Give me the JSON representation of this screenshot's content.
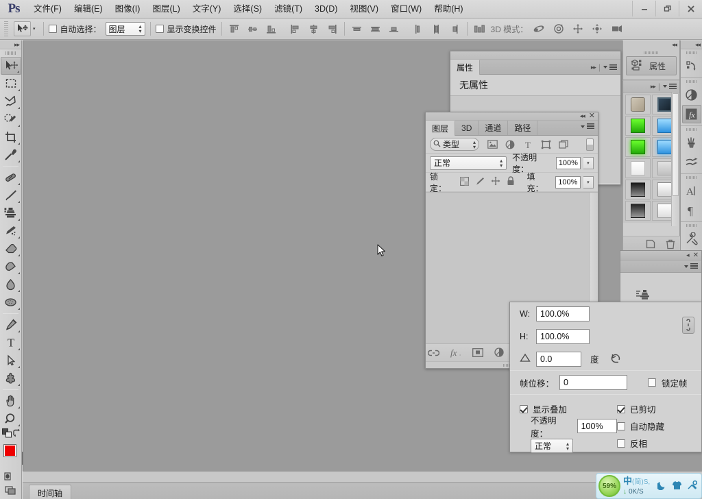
{
  "app": {
    "logo": "Ps"
  },
  "menubar": {
    "items": [
      {
        "label": "文件(F)"
      },
      {
        "label": "编辑(E)"
      },
      {
        "label": "图像(I)"
      },
      {
        "label": "图层(L)"
      },
      {
        "label": "文字(Y)"
      },
      {
        "label": "选择(S)"
      },
      {
        "label": "滤镜(T)"
      },
      {
        "label": "3D(D)"
      },
      {
        "label": "视图(V)"
      },
      {
        "label": "窗口(W)"
      },
      {
        "label": "帮助(H)"
      }
    ],
    "window_controls": [
      {
        "name": "minimize",
        "glyph": "—"
      },
      {
        "name": "restore",
        "glyph": "❐"
      },
      {
        "name": "close",
        "glyph": "✕"
      }
    ]
  },
  "options_bar": {
    "tool_icon": "move-tool-icon",
    "auto_select_label": "自动选择：",
    "auto_select_checked": false,
    "layer_select_value": "图层",
    "show_transform_label": "显示变换控件",
    "show_transform_checked": false,
    "align_icons": [
      "align-top-edges-icon",
      "align-vertical-centers-icon",
      "align-bottom-edges-icon",
      "align-left-edges-icon",
      "align-horizontal-centers-icon",
      "align-right-edges-icon"
    ],
    "distribute_icons": [
      "distribute-top-edges-icon",
      "distribute-vertical-centers-icon",
      "distribute-bottom-edges-icon",
      "distribute-left-edges-icon",
      "distribute-horizontal-centers-icon",
      "distribute-right-edges-icon"
    ],
    "extra_icon": "align-options-icon",
    "mode3d_label": "3D 模式：",
    "mode3d_icons": [
      "orbit-3d-icon",
      "roll-3d-icon",
      "pan-3d-icon",
      "slide-3d-icon",
      "zoom-3d-camera-icon"
    ]
  },
  "toolbar": {
    "collapse_icon": "double-chevron-right-icon",
    "tools": [
      {
        "name": "move-tool",
        "active": true
      },
      {
        "name": "rectangular-marquee-tool",
        "active": false
      },
      {
        "name": "lasso-tool",
        "active": false
      },
      {
        "name": "quick-selection-tool",
        "active": false
      },
      {
        "name": "crop-tool",
        "active": false
      },
      {
        "name": "eyedropper-tool",
        "active": false
      },
      {
        "name": "spot-healing-brush-tool",
        "active": false
      },
      {
        "name": "brush-tool",
        "active": false
      },
      {
        "name": "clone-stamp-tool",
        "active": false
      },
      {
        "name": "history-brush-tool",
        "active": false
      },
      {
        "name": "eraser-tool",
        "active": false
      },
      {
        "name": "gradient-tool",
        "active": false
      },
      {
        "name": "blur-tool",
        "active": false
      },
      {
        "name": "dodge-tool",
        "active": false
      },
      {
        "name": "pen-tool",
        "active": false
      },
      {
        "name": "horizontal-type-tool",
        "active": false
      },
      {
        "name": "path-selection-tool",
        "active": false
      },
      {
        "name": "custom-shape-tool",
        "active": false
      },
      {
        "name": "hand-tool",
        "active": false
      },
      {
        "name": "zoom-tool",
        "active": false
      }
    ],
    "default_colors_icon": "default-foreground-background-icon",
    "swap_colors_icon": "swap-colors-icon",
    "foreground_color": "#ee0000",
    "background_color": "#ffffff",
    "quick_mask_icon": "quick-mask-mode-icon",
    "screen_mode_icon": "change-screen-mode-icon"
  },
  "canvas": {
    "background_color": "#9b9b9b",
    "cursor": "arrow-cursor"
  },
  "timeline": {
    "tab_label": "时间轴"
  },
  "properties_panel": {
    "tab_label": "属性",
    "empty_text": "无属性",
    "collapse_icon": "double-chevron-right-icon",
    "menu_icon": "panel-menu-icon"
  },
  "layers_panel": {
    "tabs": [
      {
        "label": "图层",
        "selected": true
      },
      {
        "label": "3D",
        "selected": false
      },
      {
        "label": "通道",
        "selected": false
      },
      {
        "label": "路径",
        "selected": false
      }
    ],
    "collapse_icon": "double-chevron-left-icon",
    "close_icon": "close-icon",
    "menu_icon": "panel-menu-icon",
    "filter_label": "类型",
    "filter_search_icon": "search-icon",
    "filter_icons": [
      "pixel-layer-filter-icon",
      "adjustment-layer-filter-icon",
      "type-layer-filter-icon",
      "shape-layer-filter-icon",
      "smart-object-filter-icon"
    ],
    "filter_toggle_icon": "filter-enable-toggle-icon",
    "blend_mode": "正常",
    "opacity_label": "不透明度：",
    "opacity_value": "100%",
    "lock_label": "锁定：",
    "lock_icons": [
      "lock-transparent-pixels-icon",
      "lock-image-pixels-icon",
      "lock-position-icon",
      "lock-all-icon"
    ],
    "fill_label": "填充：",
    "fill_value": "100%",
    "footer_icons": [
      "link-layers-icon",
      "layer-style-fx-icon",
      "add-layer-mask-icon",
      "new-adjustment-layer-icon",
      "new-group-icon",
      "new-layer-icon",
      "delete-layer-icon"
    ]
  },
  "right_dock": {
    "collapse_icon": "double-chevron-left-icon",
    "groups": [
      {
        "icons": [
          "history-icon"
        ]
      },
      {
        "icons": [
          "adjustments-icon",
          "styles-fx-icon"
        ]
      },
      {
        "icons": [
          "brush-presets-icon",
          "brush-settings-icon"
        ]
      },
      {
        "icons": [
          "character-icon",
          "paragraph-icon"
        ]
      },
      {
        "icons": [
          "tool-presets-icon"
        ]
      }
    ],
    "selected_icon": "styles-fx-icon"
  },
  "properties_icon_panel": {
    "button_label": "属性",
    "button_icon": "properties-icon",
    "collapse_icon": "double-chevron-left-icon"
  },
  "styles_panel": {
    "expand_icon": "double-chevron-right-icon",
    "menu_icon": "panel-menu-icon",
    "swatches": [
      {
        "name": "default-style",
        "color": "#b8b0a0"
      },
      {
        "name": "dark-bevel-style",
        "color": "#243442"
      },
      {
        "name": "green-glass-style",
        "color": "#35d315"
      },
      {
        "name": "blue-glass-style",
        "color": "#56b0f0"
      },
      {
        "name": "green-glow-style",
        "color": "#3ce01a"
      },
      {
        "name": "blue-glow-style",
        "color": "#5cb6f5"
      },
      {
        "name": "white-panel-style",
        "color": "#f6f6f6"
      },
      {
        "name": "gray-panel-style",
        "color": "#d0d0d0"
      },
      {
        "name": "black-gradient-style",
        "color": "#2b2b2b"
      },
      {
        "name": "white-gradient-style",
        "color": "#f2f2f2"
      },
      {
        "name": "dark-gradient-style",
        "color": "#343434"
      },
      {
        "name": "light-gradient-style",
        "color": "#eeeeee"
      }
    ],
    "footer_icons": [
      "new-style-icon",
      "delete-style-icon"
    ]
  },
  "hidden_panel": {
    "close_icon": "close-icon",
    "collapse_icon": "collapse-icon",
    "menu_icon": "panel-menu-icon",
    "body_icon": "tool-presets-icon"
  },
  "transform_panel": {
    "width_label": "W:",
    "width_value": "100.0%",
    "height_label": "H:",
    "height_value": "100.0%",
    "link_icon": "link-aspect-ratio-icon",
    "angle_icon": "angle-icon",
    "angle_value": "0.0",
    "degree_label": "度",
    "reset_icon": "reset-transform-icon",
    "frame_offset_label": "帧位移：",
    "frame_offset_value": "0",
    "lock_frame_label": "锁定帧",
    "lock_frame_checked": false,
    "show_overlay_label": "显示叠加",
    "show_overlay_checked": true,
    "overlay_opacity_label": "不透明度：",
    "overlay_opacity_value": "100%",
    "overlay_blend_mode": "正常",
    "clipped_label": "已剪切",
    "clipped_checked": true,
    "auto_hide_label": "自动隐藏",
    "auto_hide_checked": false,
    "invert_label": "反相",
    "invert_checked": false
  },
  "ime_bar": {
    "battery_percent": "59%",
    "mode_main": "中",
    "mode_sub1": "(简)",
    "mode_sub2": "S,",
    "download_arrow": "↓",
    "speed": "0K/S",
    "icons": [
      "moon-icon",
      "skin-icon",
      "wrench-icon"
    ]
  }
}
